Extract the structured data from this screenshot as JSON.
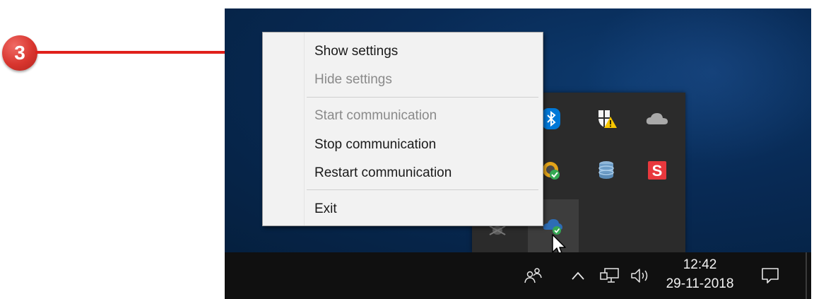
{
  "callout": {
    "number": "3"
  },
  "context_menu": {
    "items": [
      {
        "label": "Show settings",
        "enabled": true
      },
      {
        "label": "Hide settings",
        "enabled": false
      },
      {
        "label": "Start communication",
        "enabled": false
      },
      {
        "label": "Stop communication",
        "enabled": true
      },
      {
        "label": "Restart communication",
        "enabled": true
      },
      {
        "label": "Exit",
        "enabled": true
      }
    ]
  },
  "tray_overflow": {
    "icons": [
      "bluetooth-icon",
      "windows-security-icon",
      "onedrive-icon",
      "app-check-icon",
      "database-icon",
      "snagit-icon",
      "bug-icon",
      "cloud-check-icon"
    ]
  },
  "taskbar": {
    "clock_time": "12:42",
    "clock_date": "29-11-2018",
    "icons": [
      "people-icon",
      "show-hidden-icons-chevron",
      "network-icon",
      "volume-icon",
      "action-center-icon"
    ]
  },
  "colors": {
    "callout_red": "#d8352e",
    "desktop_blue": "#082a55",
    "taskbar": "#101010",
    "menu_bg": "#f2f2f2",
    "disabled_text": "#8a8a8a"
  }
}
